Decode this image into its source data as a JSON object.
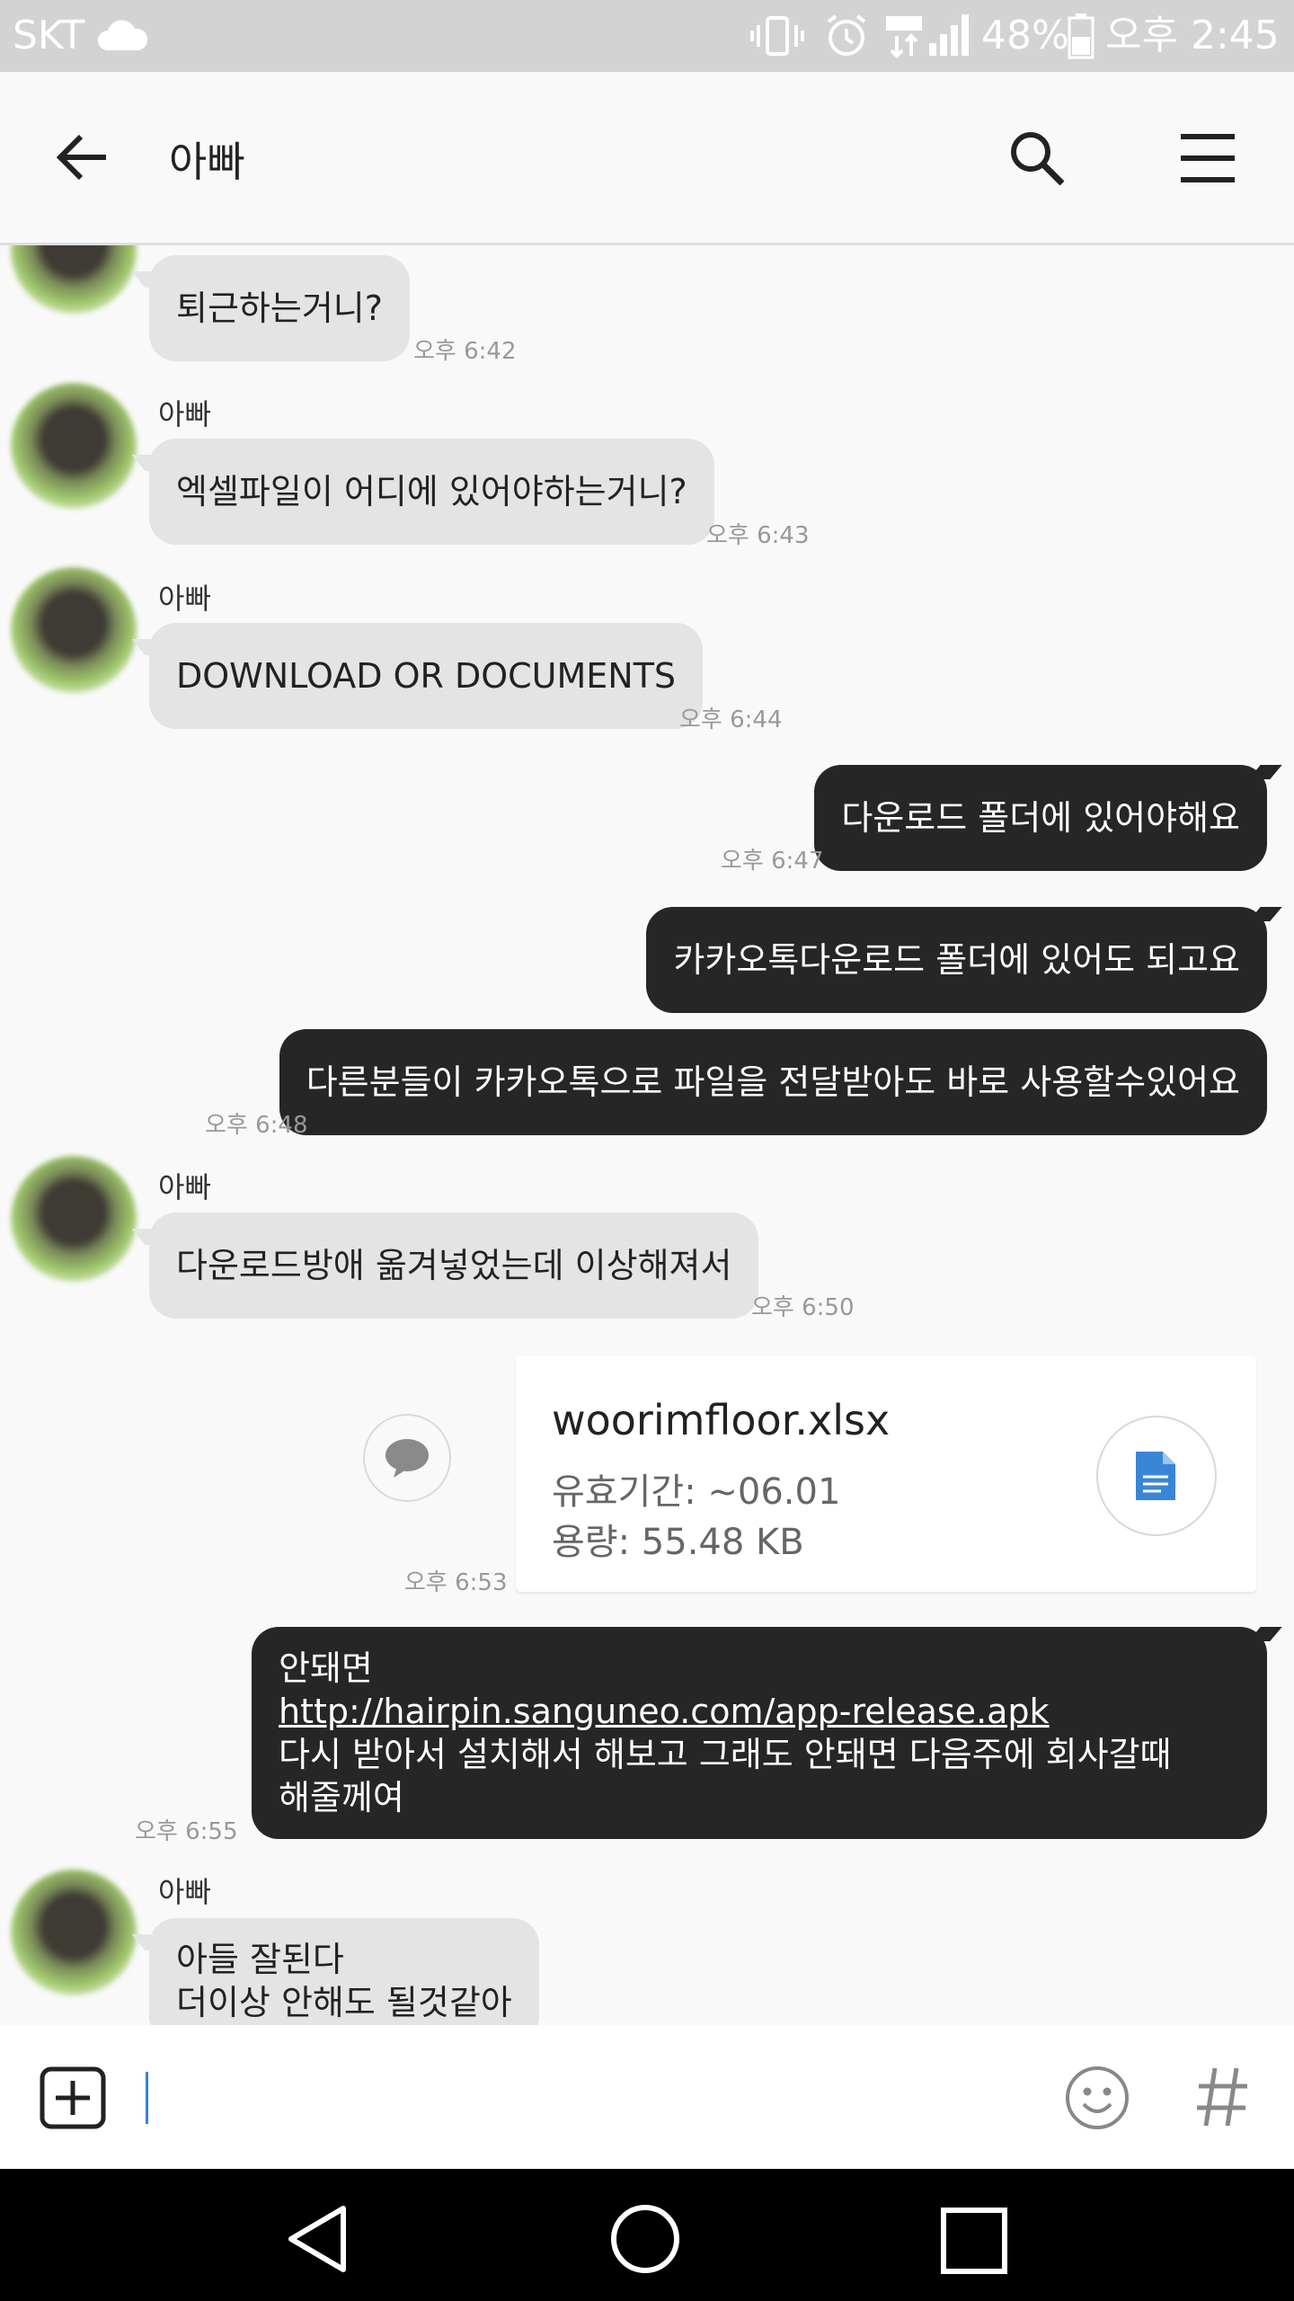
{
  "status_bar": {
    "carrier": "SKT",
    "battery": "48%",
    "time": "오후 2:45"
  },
  "header": {
    "title": "아빠"
  },
  "messages": [
    {
      "text": "퇴근하는거니?",
      "time": "오후 6:42"
    },
    {
      "sender": "아빠",
      "text": "엑셀파일이 어디에 있어야하는거니?",
      "time": "오후 6:43"
    },
    {
      "sender": "아빠",
      "text": "DOWNLOAD OR DOCUMENTS",
      "time": "오후 6:44"
    },
    {
      "text": "다운로드 폴더에 있어야해요",
      "time": "오후 6:47"
    },
    {
      "text": "카카오톡다운로드 폴더에 있어도 되고요"
    },
    {
      "text": "다른분들이 카카오톡으로 파일을 전달받아도 바로 사용할수있어요",
      "time": "오후 6:48"
    },
    {
      "sender": "아빠",
      "text": "다운로드방애 옮겨넣었는데 이상해져서",
      "time": "오후 6:50"
    },
    {
      "file_name": "woorimfloor.xlsx",
      "expiry": "유효기간: ~06.01",
      "size": "용량: 55.48 KB",
      "time": "오후 6:53"
    },
    {
      "line1": "안돼면",
      "link": "http://hairpin.sanguneo.com/app-release.apk",
      "line3": "다시 받아서 설치해서 해보고 그래도 안돼면 다음주에 회사갈때",
      "line4": "해줄께여",
      "time": "오후 6:55"
    },
    {
      "sender": "아빠",
      "line1": "아들 잘된다",
      "line2": "더이상 안해도 될것같아"
    }
  ],
  "input": {
    "value": ""
  }
}
